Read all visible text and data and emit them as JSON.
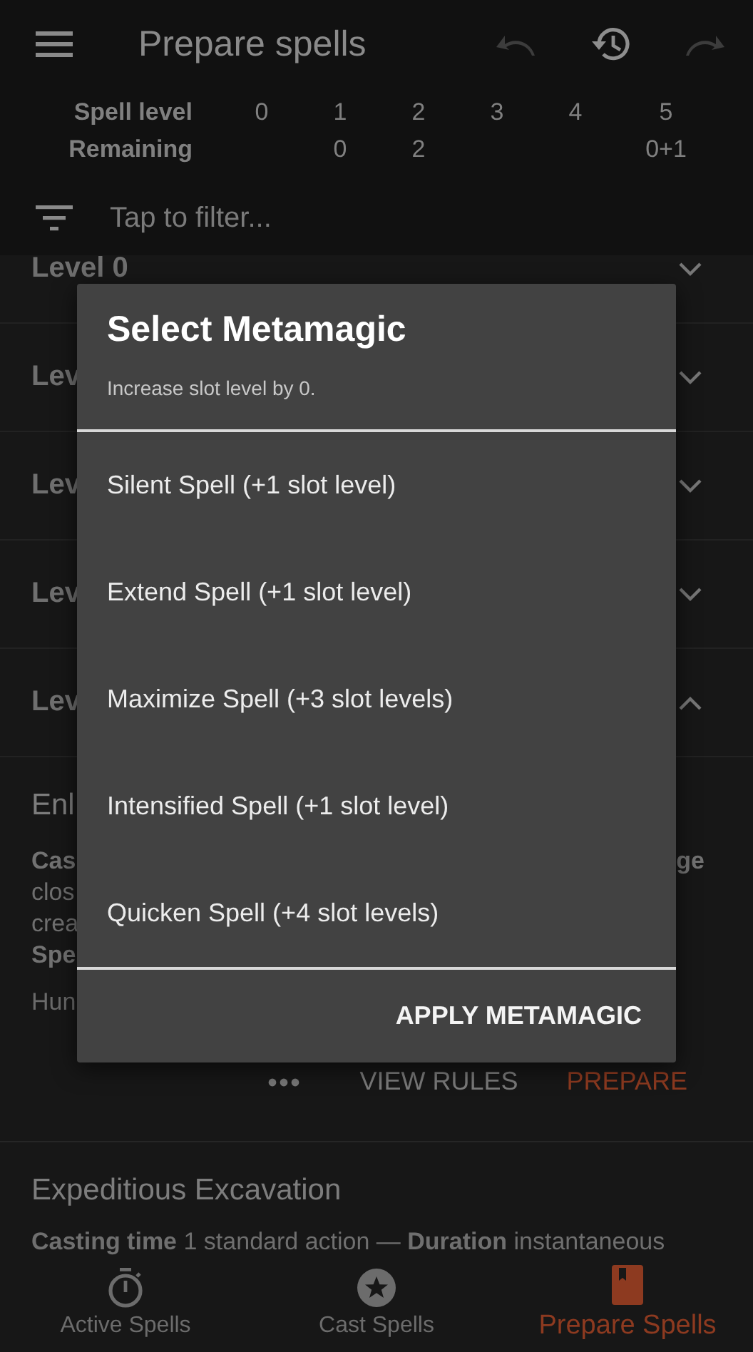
{
  "app_bar": {
    "title": "Prepare spells",
    "actions": [
      {
        "kind": "undo",
        "disabled": true
      },
      {
        "kind": "history",
        "disabled": false
      },
      {
        "kind": "redo",
        "disabled": true
      }
    ]
  },
  "slot_table": {
    "level_label": "Spell level",
    "remaining_label": "Remaining",
    "columns": [
      {
        "level": "0"
      },
      {
        "level": "1",
        "remaining": "0"
      },
      {
        "level": "2",
        "remaining": "2"
      },
      {
        "level": "3"
      },
      {
        "level": "4"
      },
      {
        "level": "5",
        "remaining": "0+1"
      }
    ]
  },
  "filter": {
    "placeholder": "Tap to filter..."
  },
  "sections": [
    {
      "label": "Level 0",
      "expanded": false
    },
    {
      "label": "Lev",
      "expanded": false
    },
    {
      "label": "Lev",
      "expanded": false
    },
    {
      "label": "Lev",
      "expanded": false
    },
    {
      "label": "Lev",
      "expanded": true
    }
  ],
  "expanded_spell": {
    "title": "Enl",
    "lines": [
      {
        "text": "Cas",
        "kind": "bold"
      },
      {
        "text": "clos",
        "kind": "plain"
      },
      {
        "text": "crea",
        "kind": "plain"
      },
      {
        "text": "Spe",
        "kind": "bold"
      }
    ],
    "right_fragment": "ge",
    "note": "Hun",
    "actions": [
      "VIEW RULES",
      "PREPARE"
    ]
  },
  "next_spell": {
    "title": "Expeditious Excavation",
    "details": "**Casting time** 1 standard action — **Duration** instantaneous"
  },
  "dialog": {
    "title": "Select Metamagic",
    "subtitle": "Increase slot level by 0.",
    "options": [
      "Silent Spell (+1 slot level)",
      "Extend Spell (+1 slot level)",
      "Maximize Spell (+3 slot levels)",
      "Intensified Spell (+1 slot level)",
      "Quicken Spell (+4 slot levels)"
    ],
    "button": "APPLY METAMAGIC"
  },
  "bottom_nav": [
    {
      "kind": "timer",
      "label": "Active Spells",
      "selected": false
    },
    {
      "kind": "star",
      "label": "Cast Spells",
      "selected": false
    },
    {
      "kind": "book",
      "label": "Prepare Spells",
      "selected": true
    }
  ]
}
